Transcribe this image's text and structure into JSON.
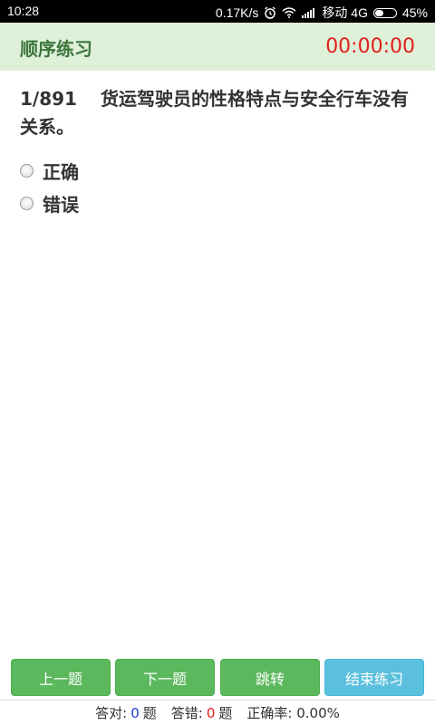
{
  "status_bar": {
    "time": "10:28",
    "net_speed": "0.17K/s",
    "carrier": "移动 4G",
    "battery_percent": "45%",
    "battery_level": 0.45,
    "icons": [
      "alarm-icon",
      "wifi-icon",
      "signal-icon",
      "battery-icon"
    ]
  },
  "header": {
    "title": "顺序练习",
    "timer": "00:00:00"
  },
  "question": {
    "number": "1/891",
    "text": "货运驾驶员的性格特点与安全行车没有关系。"
  },
  "options": [
    {
      "label": "正确"
    },
    {
      "label": "错误"
    }
  ],
  "buttons": {
    "prev": "上一题",
    "next": "下一题",
    "jump": "跳转",
    "finish": "结束练习"
  },
  "stats": {
    "correct_label": "答对:",
    "correct_value": "0",
    "correct_unit": "题",
    "wrong_label": "答错:",
    "wrong_value": "0",
    "wrong_unit": "题",
    "rate_label": "正确率:",
    "rate_value": "0.00%"
  },
  "colors": {
    "header_bg": "#dff0d8",
    "title": "#3c763d",
    "timer": "#e0201b",
    "green_button": "#5cb85c",
    "blue_button": "#5bc0de"
  }
}
